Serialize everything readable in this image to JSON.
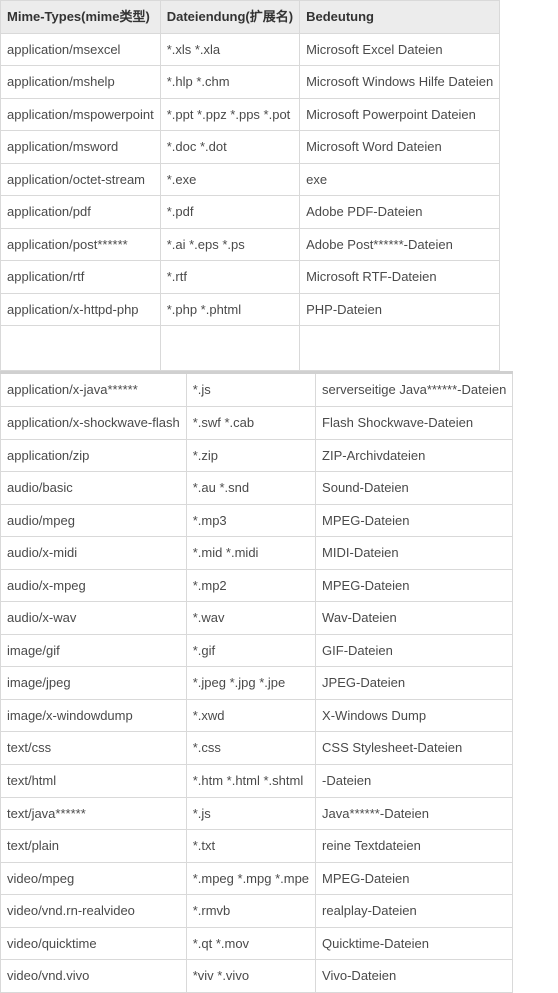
{
  "table1": {
    "headers": [
      "Mime-Types(mime类型)",
      "Dateiendung(扩展名)",
      "Bedeutung"
    ],
    "rows": [
      [
        "application/msexcel",
        "*.xls *.xla",
        "Microsoft Excel Dateien"
      ],
      [
        "application/mshelp",
        "*.hlp *.chm",
        "Microsoft Windows Hilfe Dateien"
      ],
      [
        "application/mspowerpoint",
        "*.ppt *.ppz *.pps *.pot",
        "Microsoft Powerpoint Dateien"
      ],
      [
        "application/msword",
        "*.doc *.dot",
        "Microsoft Word Dateien"
      ],
      [
        "application/octet-stream",
        "*.exe",
        "exe"
      ],
      [
        "application/pdf",
        "*.pdf",
        "Adobe PDF-Dateien"
      ],
      [
        "application/post******",
        "*.ai *.eps *.ps",
        "Adobe Post******-Dateien"
      ],
      [
        "application/rtf",
        "*.rtf",
        "Microsoft RTF-Dateien"
      ],
      [
        "application/x-httpd-php",
        "*.php *.phtml",
        "PHP-Dateien"
      ],
      [
        "",
        "",
        ""
      ]
    ]
  },
  "table2": {
    "rows": [
      [
        "application/x-java******",
        "*.js",
        "serverseitige Java******-Dateien"
      ],
      [
        "application/x-shockwave-flash",
        "*.swf *.cab",
        "Flash Shockwave-Dateien"
      ],
      [
        "application/zip",
        "*.zip",
        "ZIP-Archivdateien"
      ],
      [
        "audio/basic",
        "*.au *.snd",
        "Sound-Dateien"
      ],
      [
        "audio/mpeg",
        "*.mp3",
        "MPEG-Dateien"
      ],
      [
        "audio/x-midi",
        "*.mid *.midi",
        "MIDI-Dateien"
      ],
      [
        "audio/x-mpeg",
        "*.mp2",
        "MPEG-Dateien"
      ],
      [
        "audio/x-wav",
        "*.wav",
        "Wav-Dateien"
      ],
      [
        "image/gif",
        "*.gif",
        "GIF-Dateien"
      ],
      [
        "image/jpeg",
        "*.jpeg *.jpg *.jpe",
        "JPEG-Dateien"
      ],
      [
        "image/x-windowdump",
        "*.xwd",
        "X-Windows Dump"
      ],
      [
        "text/css",
        "*.css",
        "CSS Stylesheet-Dateien"
      ],
      [
        "text/html",
        "*.htm *.html *.shtml",
        "-Dateien"
      ],
      [
        "text/java******",
        "*.js",
        "Java******-Dateien"
      ],
      [
        "text/plain",
        "*.txt",
        "reine Textdateien"
      ],
      [
        "video/mpeg",
        "*.mpeg *.mpg *.mpe",
        "MPEG-Dateien"
      ],
      [
        "video/vnd.rn-realvideo",
        "*.rmvb",
        "realplay-Dateien"
      ],
      [
        "video/quicktime",
        "*.qt *.mov",
        "Quicktime-Dateien"
      ],
      [
        "video/vnd.vivo",
        "*viv *.vivo",
        "Vivo-Dateien"
      ]
    ]
  }
}
